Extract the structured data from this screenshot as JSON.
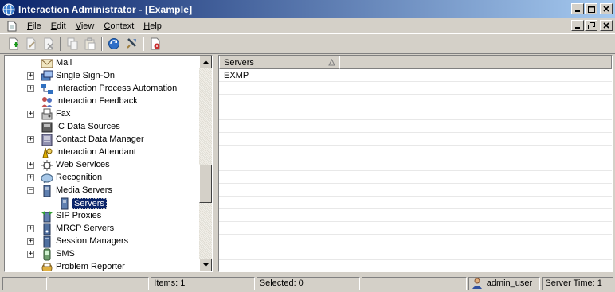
{
  "window": {
    "title": "Interaction Administrator - [Example]"
  },
  "menu": [
    {
      "label": "File",
      "ul": "F",
      "rest": "ile"
    },
    {
      "label": "Edit",
      "ul": "E",
      "rest": "dit"
    },
    {
      "label": "View",
      "ul": "V",
      "rest": "iew"
    },
    {
      "label": "Context",
      "ul": "C",
      "rest": "ontext"
    },
    {
      "label": "Help",
      "ul": "H",
      "rest": "elp"
    }
  ],
  "toolbar": [
    {
      "name": "new-icon"
    },
    {
      "name": "edit-icon"
    },
    {
      "name": "delete-icon"
    },
    {
      "name": "copy-icon"
    },
    {
      "name": "paste-icon"
    },
    {
      "name": "refresh-icon"
    },
    {
      "name": "filter-icon"
    },
    {
      "name": "help-icon"
    }
  ],
  "tree": {
    "items": [
      {
        "label": "Mail",
        "icon": "mail-icon",
        "expander": ""
      },
      {
        "label": "Single Sign-On",
        "icon": "sso-icon",
        "expander": "+"
      },
      {
        "label": "Interaction Process Automation",
        "icon": "ipa-icon",
        "expander": "+"
      },
      {
        "label": "Interaction Feedback",
        "icon": "feedback-icon",
        "expander": ""
      },
      {
        "label": "Fax",
        "icon": "fax-icon",
        "expander": "+"
      },
      {
        "label": "IC Data Sources",
        "icon": "datasource-icon",
        "expander": ""
      },
      {
        "label": "Contact Data Manager",
        "icon": "contact-data-icon",
        "expander": "+"
      },
      {
        "label": "Interaction Attendant",
        "icon": "attendant-icon",
        "expander": ""
      },
      {
        "label": "Web Services",
        "icon": "web-services-icon",
        "expander": "+"
      },
      {
        "label": "Recognition",
        "icon": "recognition-icon",
        "expander": "+"
      },
      {
        "label": "Media Servers",
        "icon": "media-server-icon",
        "expander": "−"
      },
      {
        "label": "Servers",
        "icon": "server-icon",
        "expander": "",
        "child": true,
        "selected": true
      },
      {
        "label": "SIP Proxies",
        "icon": "sip-proxy-icon",
        "expander": ""
      },
      {
        "label": "MRCP Servers",
        "icon": "mrcp-icon",
        "expander": "+"
      },
      {
        "label": "Session Managers",
        "icon": "session-manager-icon",
        "expander": "+"
      },
      {
        "label": "SMS",
        "icon": "sms-icon",
        "expander": "+"
      },
      {
        "label": "Problem Reporter",
        "icon": "problem-reporter-icon",
        "expander": ""
      }
    ]
  },
  "list": {
    "columns": [
      "Servers",
      ""
    ],
    "rows": [
      [
        "EXMP",
        ""
      ]
    ]
  },
  "status": {
    "items": "Items: 1",
    "selected": "Selected: 0",
    "user": "admin_user",
    "server_time": "Server Time: 1"
  }
}
